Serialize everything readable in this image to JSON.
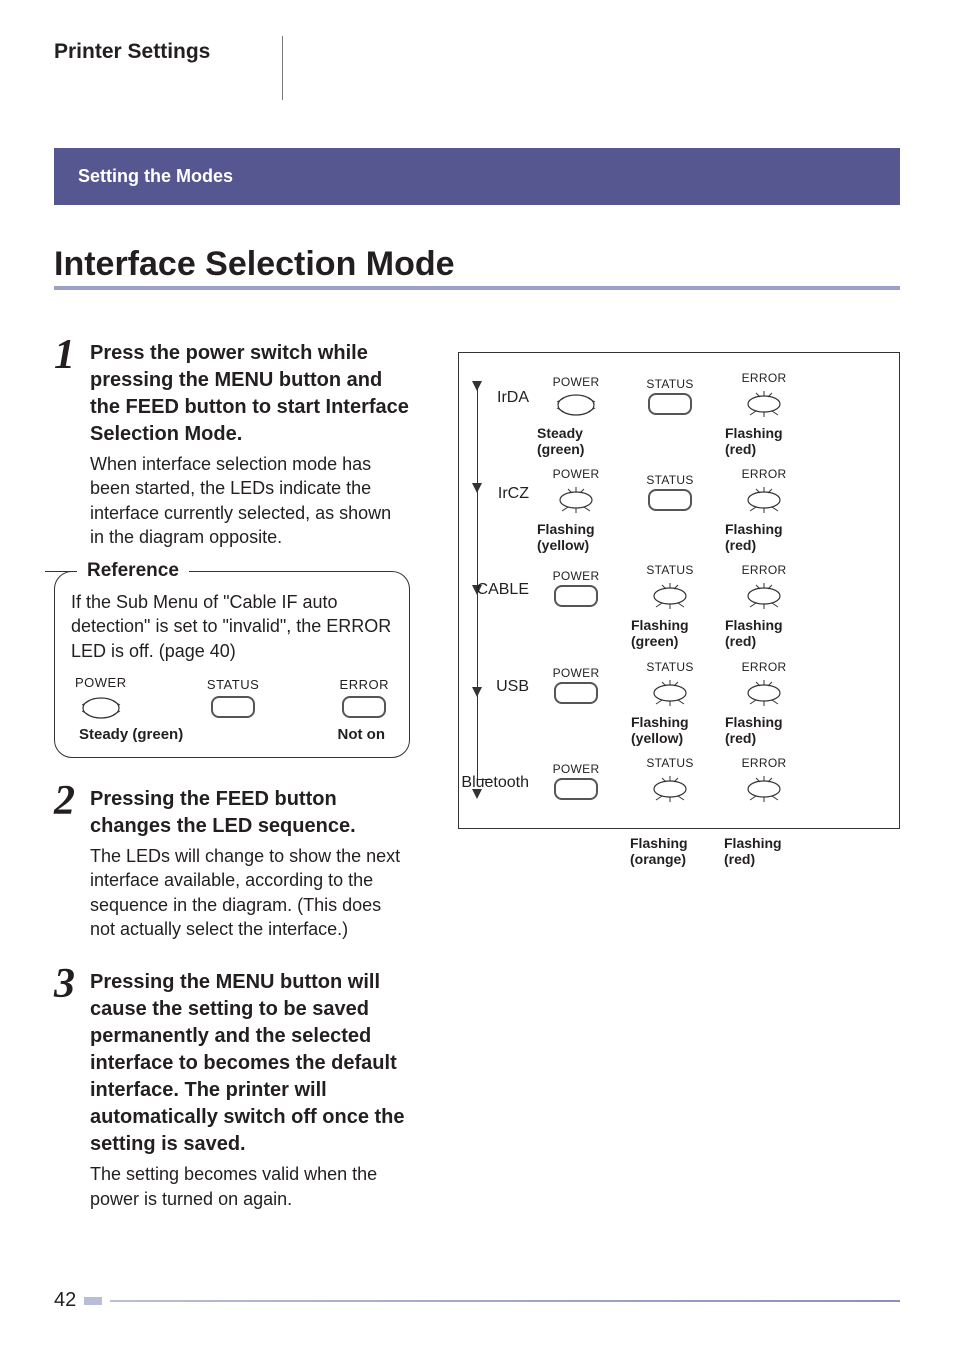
{
  "section_title": "Printer Settings",
  "banner": "Setting the Modes",
  "heading": "Interface Selection Mode",
  "steps": {
    "s1": {
      "num": "1",
      "head": "Press the power switch while pressing the MENU button and the FEED button to start Interface Selection Mode.",
      "text": "When interface selection mode has been started, the LEDs indicate the interface currently selected, as shown in the diagram opposite."
    },
    "s2": {
      "num": "2",
      "head": "Pressing the FEED button changes the LED sequence.",
      "text": "The LEDs will change to show the next interface available, according to the sequence in the diagram. (This does not actually select the interface.)"
    },
    "s3": {
      "num": "3",
      "head": "Pressing the MENU button will cause the setting to be saved permanently and the selected interface to becomes the default interface. The printer will automatically switch off once the setting is saved.",
      "text": "The setting becomes valid when the power is turned on again."
    }
  },
  "reference": {
    "label": "Reference",
    "text": "If the Sub Menu of \"Cable IF auto detection\" is set to \"invalid\", the ERROR LED is off. (page 40)",
    "led_headers": {
      "power": "POWER",
      "status": "STATUS",
      "error": "ERROR"
    },
    "caption_left": "Steady (green)",
    "caption_right": "Not on"
  },
  "diagram": {
    "headers": {
      "power": "POWER",
      "status": "STATUS",
      "error": "ERROR"
    },
    "rows": [
      {
        "label": "IrDA",
        "power": "steady",
        "status": "off",
        "error": "flash",
        "pcap": "Steady (green)",
        "scap": "",
        "ecap": "Flashing (red)"
      },
      {
        "label": "IrCZ",
        "power": "flash",
        "status": "off",
        "error": "flash",
        "pcap": "Flashing (yellow)",
        "scap": "",
        "ecap": "Flashing (red)"
      },
      {
        "label": "CABLE",
        "power": "off",
        "status": "flash",
        "error": "flash",
        "pcap": "",
        "scap": "Flashing (green)",
        "ecap": "Flashing (red)"
      },
      {
        "label": "USB",
        "power": "off",
        "status": "flash",
        "error": "flash",
        "pcap": "",
        "scap": "Flashing (yellow)",
        "ecap": "Flashing (red)"
      },
      {
        "label": "Bluetooth",
        "power": "off",
        "status": "flash",
        "error": "flash",
        "pcap": "",
        "scap": "Flashing (orange)",
        "ecap": "Flashing (red)"
      }
    ]
  },
  "page_number": "42"
}
